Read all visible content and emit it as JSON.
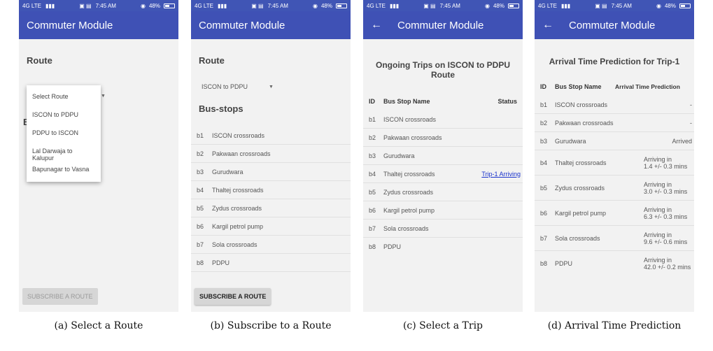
{
  "status": {
    "network": "4G LTE",
    "time": "7:45 AM",
    "battery": "48%"
  },
  "app_title": "Commuter Module",
  "screen1": {
    "route_label": "Route",
    "dropdown": [
      "Select Route",
      "ISCON to PDPU",
      "PDPU to ISCON",
      "Lal Darwaja to Kalupur",
      "Bapunagar to Vasna"
    ],
    "peek_letter": "B",
    "button": "SUBSCRIBE A ROUTE"
  },
  "screen2": {
    "route_label": "Route",
    "selected_route": "ISCON to PDPU",
    "busstops_label": "Bus-stops",
    "stops": [
      {
        "id": "b1",
        "name": "ISCON crossroads"
      },
      {
        "id": "b2",
        "name": "Pakwaan crossroads"
      },
      {
        "id": "b3",
        "name": "Gurudwara"
      },
      {
        "id": "b4",
        "name": "Thaltej crossroads"
      },
      {
        "id": "b5",
        "name": "Zydus crossroads"
      },
      {
        "id": "b6",
        "name": "Kargil petrol pump"
      },
      {
        "id": "b7",
        "name": "Sola crossroads"
      },
      {
        "id": "b8",
        "name": "PDPU"
      }
    ],
    "button": "SUBSCRIBE A ROUTE"
  },
  "screen3": {
    "heading": "Ongoing Trips on ISCON to PDPU Route",
    "headers": {
      "id": "ID",
      "name": "Bus Stop Name",
      "status": "Status"
    },
    "rows": [
      {
        "id": "b1",
        "name": "ISCON crossroads",
        "status": ""
      },
      {
        "id": "b2",
        "name": "Pakwaan crossroads",
        "status": ""
      },
      {
        "id": "b3",
        "name": "Gurudwara",
        "status": ""
      },
      {
        "id": "b4",
        "name": "Thaltej crossroads",
        "status": "Trip-1 Arriving"
      },
      {
        "id": "b5",
        "name": "Zydus crossroads",
        "status": ""
      },
      {
        "id": "b6",
        "name": "Kargil petrol pump",
        "status": ""
      },
      {
        "id": "b7",
        "name": "Sola crossroads",
        "status": ""
      },
      {
        "id": "b8",
        "name": "PDPU",
        "status": ""
      }
    ]
  },
  "screen4": {
    "heading": "Arrival Time Prediction for Trip-1",
    "headers": {
      "id": "ID",
      "name": "Bus Stop Name",
      "status": "Arrival Time Prediction"
    },
    "rows": [
      {
        "id": "b1",
        "name": "ISCON crossroads",
        "status": "-"
      },
      {
        "id": "b2",
        "name": "Pakwaan crossroads",
        "status": "-"
      },
      {
        "id": "b3",
        "name": "Gurudwara",
        "status": "Arrived"
      },
      {
        "id": "b4",
        "name": "Thaltej crossroads",
        "status": "Arriving in\n1.4 +/- 0.3 mins"
      },
      {
        "id": "b5",
        "name": "Zydus crossroads",
        "status": "Arriving in\n3.0 +/- 0.3 mins"
      },
      {
        "id": "b6",
        "name": "Kargil petrol pump",
        "status": "Arriving in\n6.3 +/- 0.3 mins"
      },
      {
        "id": "b7",
        "name": "Sola crossroads",
        "status": "Arriving in\n9.6 +/- 0.6 mins"
      },
      {
        "id": "b8",
        "name": "PDPU",
        "status": "Arriving in\n42.0 +/- 0.2 mins"
      }
    ]
  },
  "captions": [
    "(a) Select a Route",
    "(b) Subscribe to a Route",
    "(c) Select a Trip",
    "(d) Arrival Time Prediction"
  ]
}
